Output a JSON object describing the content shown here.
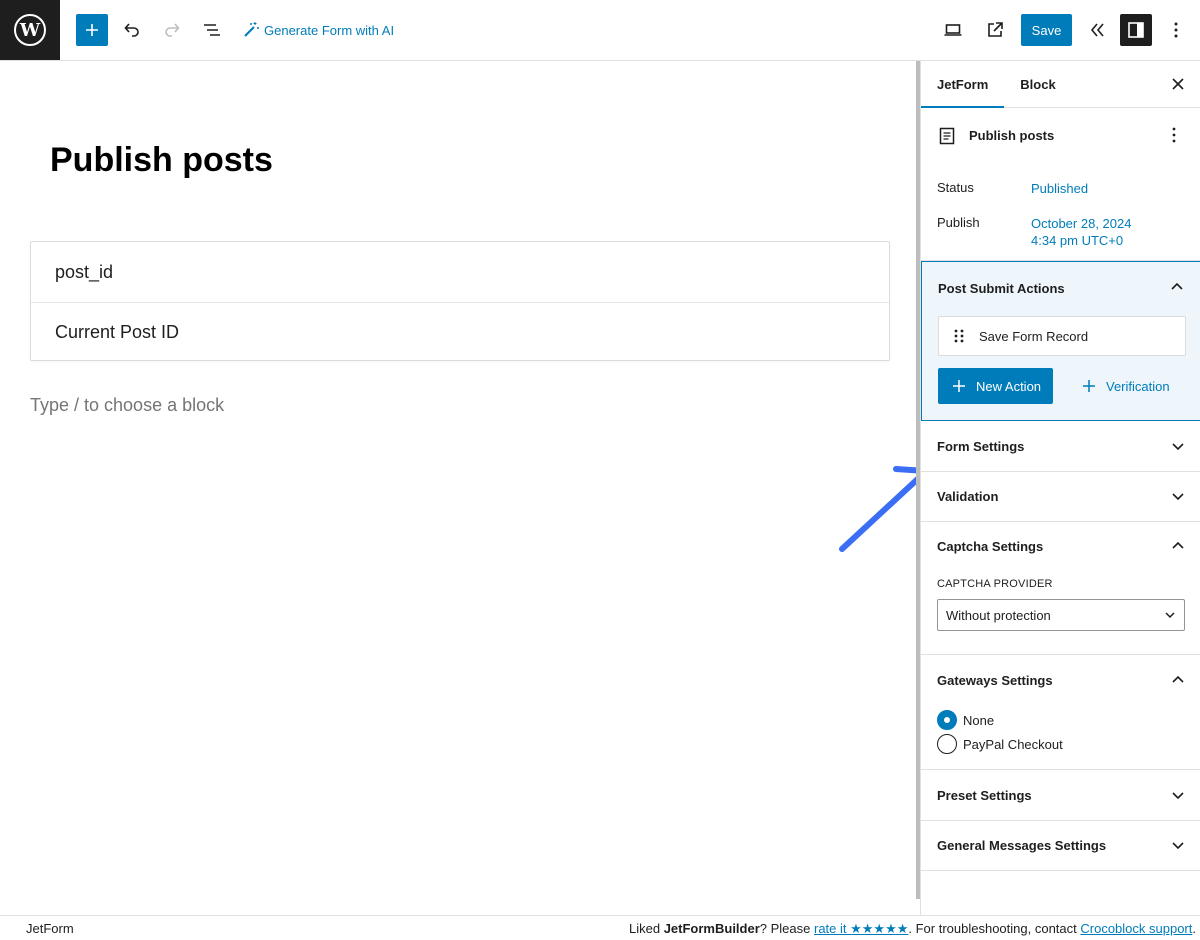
{
  "toolbar": {
    "ai_label": "Generate Form with AI",
    "save_label": "Save"
  },
  "editor": {
    "title": "Publish posts",
    "fields": [
      {
        "label": "post_id"
      },
      {
        "label": "Current Post ID"
      }
    ],
    "block_placeholder": "Type / to choose a block"
  },
  "sidebar": {
    "tabs": [
      "JetForm",
      "Block"
    ],
    "doc_title": "Publish posts",
    "status_label": "Status",
    "status_value": "Published",
    "publish_label": "Publish",
    "publish_date": "October 28, 2024",
    "publish_time": "4:34 pm UTC+0",
    "post_submit": {
      "title": "Post Submit Actions",
      "action": "Save Form Record",
      "new_action": "New Action",
      "verification": "Verification"
    },
    "panels": {
      "form_settings": "Form Settings",
      "validation": "Validation",
      "captcha": "Captcha Settings",
      "gateways": "Gateways Settings",
      "preset": "Preset Settings",
      "general_messages": "General Messages Settings"
    },
    "captcha": {
      "provider_label": "CAPTCHA PROVIDER",
      "selected": "Without protection"
    },
    "gateways": {
      "options": [
        "None",
        "PayPal Checkout"
      ],
      "selected": "None"
    }
  },
  "footer": {
    "left": "JetForm",
    "liked": "Liked ",
    "product": "JetFormBuilder",
    "please": "? Please ",
    "rate_link": "rate it ★★★★★",
    "troubleshoot": ". For troubleshooting, contact ",
    "support_link": "Crocoblock support",
    "end": "."
  },
  "colors": {
    "accent": "#007cba",
    "arrow": "#3b6ef5",
    "dark": "#1e1e1e"
  }
}
